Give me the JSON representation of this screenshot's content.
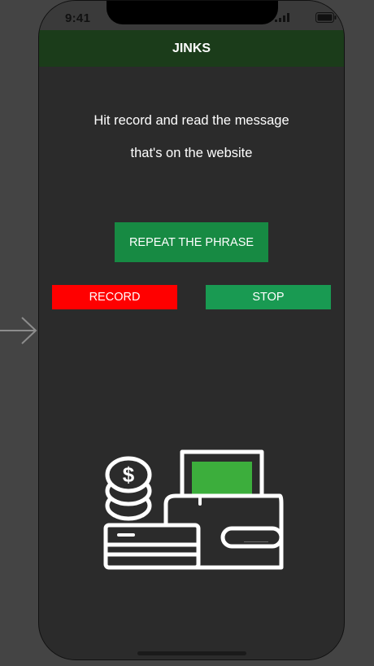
{
  "status_bar": {
    "time": "9:41"
  },
  "nav": {
    "title": "JINKS"
  },
  "instructions": {
    "line1": "Hit record and read the message",
    "line2": "that's on the website"
  },
  "buttons": {
    "repeat_label": "REPEAT THE PHRASE",
    "record_label": "RECORD",
    "stop_label": "STOP"
  },
  "icons": {
    "entry_point": "arrow-right-icon",
    "illustration": "money-wallet-icon",
    "signal": "signal-icon",
    "battery": "battery-icon"
  },
  "colors": {
    "nav_background": "#1b3c1a",
    "screen_background": "#2b2b2b",
    "repeat_button": "#178a43",
    "record_button": "#ff0000",
    "stop_button": "#199a52",
    "cash_green": "#3cae3c"
  }
}
